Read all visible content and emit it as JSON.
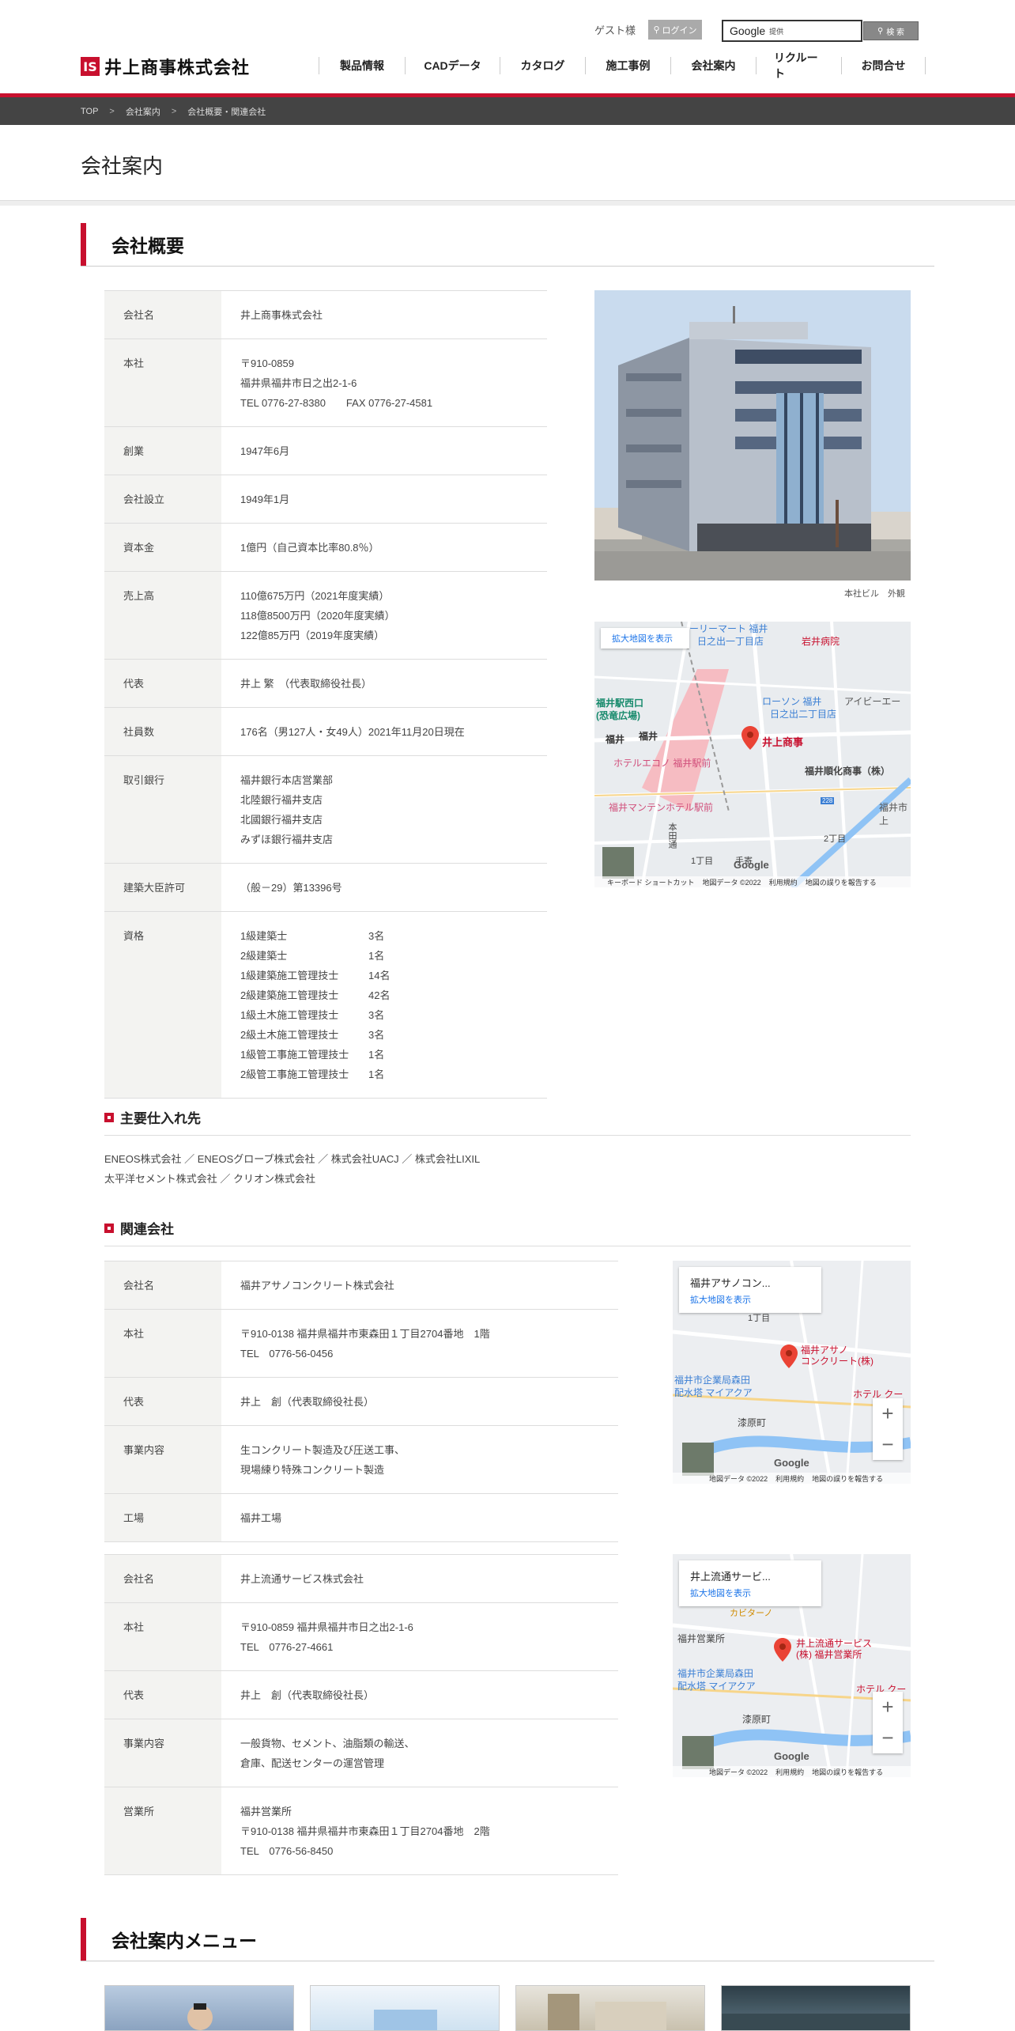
{
  "header": {
    "guest": "ゲスト様",
    "login": "ログイン",
    "search_brand": "Google",
    "search_provided": "提供",
    "search_button": "検 索",
    "logo_mark": "IS",
    "logo_text": "井上商事株式会社",
    "nav": [
      "製品情報",
      "CADデータ",
      "カタログ",
      "施工事例",
      "会社案内",
      "リクルート",
      "お問合せ"
    ]
  },
  "breadcrumb": [
    "TOP",
    "会社案内",
    "会社概要・関連会社"
  ],
  "breadcrumb_sep": ">",
  "page_title": "会社案内",
  "overview": {
    "heading": "会社概要",
    "rows": [
      {
        "label": "会社名",
        "lines": [
          "井上商事株式会社"
        ]
      },
      {
        "label": "本社",
        "lines": [
          "〒910-0859",
          "福井県福井市日之出2-1-6",
          "TEL 0776-27-8380　　FAX 0776-27-4581"
        ]
      },
      {
        "label": "創業",
        "lines": [
          "1947年6月"
        ]
      },
      {
        "label": "会社設立",
        "lines": [
          "1949年1月"
        ]
      },
      {
        "label": "資本金",
        "lines": [
          "1億円（自己資本比率80.8％）"
        ]
      },
      {
        "label": "売上高",
        "lines": [
          "110億675万円（2021年度実績）",
          "118億8500万円（2020年度実績）",
          "122億85万円（2019年度実績）"
        ]
      },
      {
        "label": "代表",
        "lines": [
          "井上 繁　（代表取締役社長）"
        ]
      },
      {
        "label": "社員数",
        "lines": [
          "176名（男127人・女49人）2021年11月20日現在"
        ]
      },
      {
        "label": "取引銀行",
        "lines": [
          "福井銀行本店営業部",
          "北陸銀行福井支店",
          "北國銀行福井支店",
          "みずほ銀行福井支店"
        ]
      },
      {
        "label": "建築大臣許可",
        "lines": [
          "（般－29）第13396号"
        ]
      }
    ],
    "qual_label": "資格",
    "quals": [
      [
        "1級建築士",
        "3名"
      ],
      [
        "2級建築士",
        "1名"
      ],
      [
        "1級建築施工管理技士",
        "14名"
      ],
      [
        "2級建築施工管理技士",
        "42名"
      ],
      [
        "1級土木施工管理技士",
        "3名"
      ],
      [
        "2級土木施工管理技士",
        "3名"
      ],
      [
        "1級管工事施工管理技士",
        "1名"
      ],
      [
        "2級管工事施工管理技士",
        "1名"
      ]
    ],
    "photo_caption": "本社ビル　外観"
  },
  "map_main": {
    "enlarge": "拡大地図を表示",
    "labels": [
      "ーリーマート 福井",
      "日之出一丁目店",
      "岩井病院",
      "福井駅西口",
      "(恐竜広場)",
      "ローソン 福井",
      "日之出二丁目店",
      "アイビーエー",
      "福井",
      "福井",
      "井上商事",
      "ホテルエコノ 福井駅前",
      "福井順化商事（株）",
      "福井マンテンホテル駅前",
      "福井市上",
      "2丁目",
      "1丁目",
      "手寄",
      "本田通",
      "228"
    ],
    "footer": [
      "キーボード ショートカット",
      "地図データ ©2022",
      "利用規約",
      "地図の誤りを報告する"
    ],
    "google": "Google"
  },
  "suppliers": {
    "heading": "主要仕入れ先",
    "lines": [
      "ENEOS株式会社 ／ ENEOSグローブ株式会社 ／ 株式会社UACJ ／ 株式会社LIXIL",
      "太平洋セメント株式会社 ／ クリオン株式会社"
    ]
  },
  "affiliates": {
    "heading": "関連会社",
    "companies": [
      {
        "rows": [
          {
            "label": "会社名",
            "lines": [
              "福井アサノコンクリート株式会社"
            ]
          },
          {
            "label": "本社",
            "lines": [
              "〒910-0138 福井県福井市東森田１丁目2704番地　1階",
              "TEL　0776-56-0456"
            ]
          },
          {
            "label": "代表",
            "lines": [
              "井上　創（代表取締役社長）"
            ]
          },
          {
            "label": "事業内容",
            "lines": [
              "生コンクリート製造及び圧送工事、",
              "現場練り特殊コンクリート製造"
            ]
          },
          {
            "label": "工場",
            "lines": [
              "福井工場"
            ]
          }
        ],
        "map": {
          "title": "福井アサノコン...",
          "enlarge": "拡大地図を表示",
          "pin": "福井アサノ",
          "pin2": "コンクリート(株)",
          "labels": [
            "1丁目",
            "福井市企業局森田",
            "配水塔 マイアクア",
            "ホテル クー",
            "漆原町"
          ],
          "footer": [
            "地図データ ©2022",
            "利用規約",
            "地図の誤りを報告する"
          ],
          "google": "Google"
        }
      },
      {
        "rows": [
          {
            "label": "会社名",
            "lines": [
              "井上流通サービス株式会社"
            ]
          },
          {
            "label": "本社",
            "lines": [
              "〒910-0859 福井県福井市日之出2-1-6",
              "TEL　0776-27-4661"
            ]
          },
          {
            "label": "代表",
            "lines": [
              "井上　創（代表取締役社長）"
            ]
          },
          {
            "label": "事業内容",
            "lines": [
              "一般貨物、セメント、油脂類の輸送、",
              "倉庫、配送センターの運営管理"
            ]
          },
          {
            "label": "営業所",
            "lines": [
              "福井営業所",
              "〒910-0138 福井県福井市東森田１丁目2704番地　2階",
              "TEL　0776-56-8450"
            ]
          }
        ],
        "map": {
          "title": "井上流通サービ...",
          "enlarge": "拡大地図を表示",
          "pin": "井上流通サービス",
          "pin2": "(株) 福井営業所",
          "labels": [
            "カビターノ",
            "福井営業所",
            "福井市企業局森田",
            "配水塔 マイアクア",
            "ホテル クー",
            "漆原町"
          ],
          "footer": [
            "地図データ ©2022",
            "利用規約",
            "地図の誤りを報告する"
          ],
          "google": "Google"
        }
      }
    ]
  },
  "menu": {
    "heading": "会社案内メニュー"
  },
  "colors": {
    "accent": "#c8102e",
    "breadcrumb_bg": "#444444",
    "table_header_bg": "#f3f3f1"
  }
}
